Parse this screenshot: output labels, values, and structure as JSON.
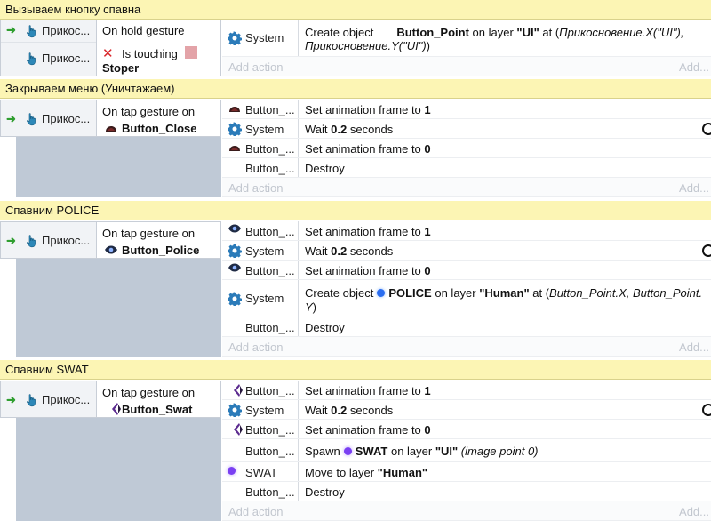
{
  "groups": [
    {
      "title": "Вызываем кнопку спавна"
    },
    {
      "title": "Закрываем меню (Уничтажаем)"
    },
    {
      "title": "Спавним POLICE"
    },
    {
      "title": "Спавним SWAT"
    }
  ],
  "common": {
    "trigger_label": "Прикос...",
    "add_action": "Add action",
    "add_right": "Add..."
  },
  "event1": {
    "cond1": "On hold gesture",
    "cond2_text": "Is touching",
    "cond2_obj": "Stoper",
    "actions": [
      {
        "object": "System",
        "pre": "Create object",
        "obj": "Button_Point",
        "mid": "on layer",
        "layer": "\"UI\"",
        "at": "at (",
        "expr1": "Прикосновение.X(\"UI\"),",
        "expr2": "Прикосновение.Y(\"UI\")",
        "end": ")"
      }
    ]
  },
  "event2": {
    "cond_line1": "On tap gesture on",
    "cond_obj": "Button_Close",
    "actions": [
      {
        "object": "Button_...",
        "text": "Set animation frame to",
        "value": "1"
      },
      {
        "object": "System",
        "text": "Wait",
        "value": "0.2",
        "suffix": "seconds"
      },
      {
        "object": "Button_...",
        "text": "Set animation frame to",
        "value": "0"
      },
      {
        "object": "Button_...",
        "text": "Destroy"
      }
    ]
  },
  "event3": {
    "cond_line1": "On tap gesture on",
    "cond_obj": "Button_Police",
    "actions": [
      {
        "object": "Button_...",
        "text": "Set animation frame to",
        "value": "1"
      },
      {
        "object": "System",
        "text": "Wait",
        "value": "0.2",
        "suffix": "seconds"
      },
      {
        "object": "Button_...",
        "text": "Set animation frame to",
        "value": "0"
      },
      {
        "object": "System",
        "pre": "Create object",
        "obj": "POLICE",
        "mid": "on layer",
        "layer": "\"Human\"",
        "at": "at (",
        "expr1": "Button_Point.X, Button_Point.",
        "expr2": "Y",
        "end": ")"
      },
      {
        "object": "Button_...",
        "text": "Destroy"
      }
    ]
  },
  "event4": {
    "cond_line1": "On tap gesture on",
    "cond_obj": "Button_Swat",
    "actions": [
      {
        "object": "Button_...",
        "text": "Set animation frame to",
        "value": "1"
      },
      {
        "object": "System",
        "text": "Wait",
        "value": "0.2",
        "suffix": "seconds"
      },
      {
        "object": "Button_...",
        "text": "Set animation frame to",
        "value": "0"
      },
      {
        "object": "Button_...",
        "pre": "Spawn",
        "obj": "SWAT",
        "mid": "on layer",
        "layer": "\"UI\"",
        "extra": "(image point 0)"
      },
      {
        "object": "SWAT",
        "pre": "Move to layer",
        "layer": "\"Human\""
      },
      {
        "object": "Button_...",
        "text": "Destroy"
      }
    ]
  },
  "icons": {
    "arrow": "event-arrow-icon",
    "hand": "touch-hand-icon",
    "gear": "system-gear-icon",
    "cross": "invert-x-icon",
    "clock": "clock-icon"
  },
  "colors": {
    "header_bg": "#fcf5b4",
    "cond_bg": "#f1f3f6",
    "left_bar": "#bfc9d6",
    "gear": "#2b7bb9",
    "arrow": "#2f9e2f",
    "cross": "#d9262a"
  }
}
